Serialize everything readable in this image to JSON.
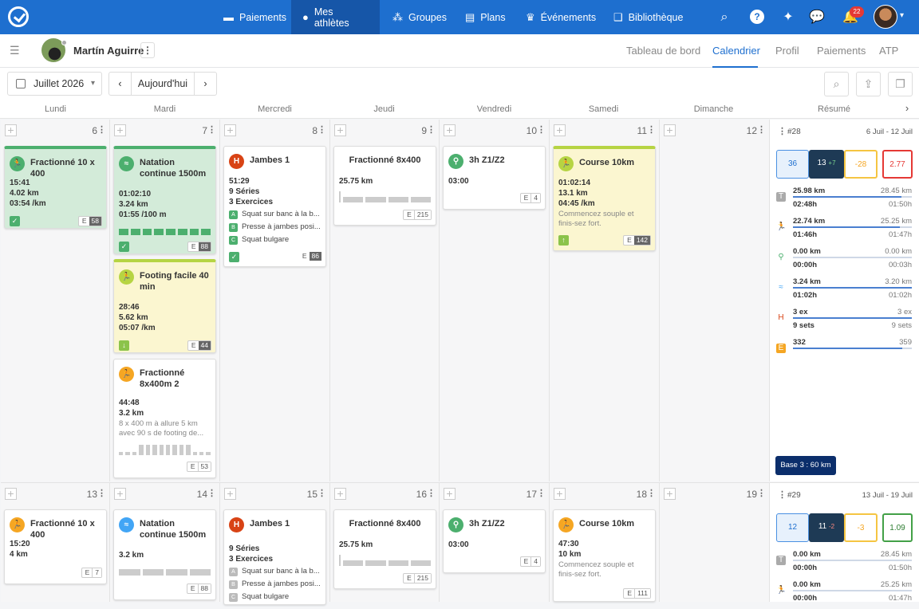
{
  "nav": {
    "items": [
      {
        "label": "Paiements",
        "icon": "credit-card-icon"
      },
      {
        "label": "Mes athlètes",
        "icon": "person-icon"
      },
      {
        "label": "Groupes",
        "icon": "group-icon"
      },
      {
        "label": "Plans",
        "icon": "clipboard-icon"
      },
      {
        "label": "Événements",
        "icon": "trophy-icon"
      },
      {
        "label": "Bibliothèque",
        "icon": "book-icon"
      }
    ],
    "notification_count": "22"
  },
  "athlete": {
    "name": "Martín Aguirre"
  },
  "tabs": [
    "Tableau de bord",
    "Calendrier",
    "Profil",
    "Paiements",
    "ATP"
  ],
  "toolbar": {
    "month": "Juillet 2026",
    "today": "Aujourd'hui"
  },
  "days": [
    "Lundi",
    "Mardi",
    "Mercredi",
    "Jeudi",
    "Vendredi",
    "Samedi",
    "Dimanche",
    "Résumé"
  ],
  "week1": {
    "daynums": [
      "6",
      "7",
      "8",
      "9",
      "10",
      "11",
      "12"
    ],
    "summary": {
      "week": "#28",
      "range": "6 Juil - 12 Juil",
      "kpis": [
        "36",
        "13",
        "+7",
        "-28",
        "2.77"
      ],
      "rows": [
        {
          "icon": "T",
          "a": "25.98 km",
          "ar": "28.45 km",
          "b": "02:48h",
          "br": "01:50h",
          "fill": 91
        },
        {
          "icon": "run",
          "a": "22.74 km",
          "ar": "25.25 km",
          "b": "01:46h",
          "br": "01:47h",
          "fill": 90
        },
        {
          "icon": "bike",
          "a": "0.00 km",
          "ar": "0.00 km",
          "b": "00:00h",
          "br": "00:03h",
          "fill": 0
        },
        {
          "icon": "swim",
          "a": "3.24 km",
          "ar": "3.20 km",
          "b": "01:02h",
          "br": "01:02h",
          "fill": 100
        },
        {
          "icon": "gym",
          "a": "3 ex",
          "ar": "3 ex",
          "b": "9 sets",
          "br": "9 sets",
          "fill": 100
        },
        {
          "icon": "E",
          "a": "332",
          "ar": "359",
          "b": "",
          "br": "",
          "fill": 92
        }
      ],
      "base": "Base 3 : 60 km"
    }
  },
  "week2": {
    "daynums": [
      "13",
      "14",
      "15",
      "16",
      "17",
      "18",
      "19"
    ],
    "summary": {
      "week": "#29",
      "range": "13 Juil - 19 Juil",
      "kpis": [
        "12",
        "11",
        "-2",
        "-3",
        "1.09"
      ],
      "rows": [
        {
          "icon": "T",
          "a": "0.00 km",
          "ar": "28.45 km",
          "b": "00:00h",
          "br": "01:50h",
          "fill": 0
        },
        {
          "icon": "run",
          "a": "0.00 km",
          "ar": "25.25 km",
          "b": "00:00h",
          "br": "01:47h",
          "fill": 0
        }
      ]
    }
  },
  "cards": {
    "w1_mon": {
      "title": "Fractionné 10 x 400",
      "l1": "15:41",
      "l2": "4.02 km",
      "l3": "03:54 /km",
      "e": "E",
      "en": "58"
    },
    "w1_tue1": {
      "title": "Natation continue 1500m",
      "l1": "01:02:10",
      "l2": "3.24 km",
      "l3": "01:55 /100 m",
      "e": "E",
      "en": "88"
    },
    "w1_tue2": {
      "title": "Footing facile 40 min",
      "l1": "28:46",
      "l2": "5.62 km",
      "l3": "05:07 /km",
      "e": "E",
      "en": "44"
    },
    "w1_tue3": {
      "title": "Fractionné 8x400m 2",
      "l1": "44:48",
      "l2": "3.2 km",
      "desc": "8 x 400 m à allure 5 km avec 90 s de footing de...",
      "e": "E",
      "en": "53"
    },
    "w1_wed": {
      "title": "Jambes 1",
      "l1": "51:29",
      "l2": "9 Séries",
      "l3": "3 Exercices",
      "ex": [
        {
          "k": "A",
          "t": "Squat sur banc à la b..."
        },
        {
          "k": "B",
          "t": "Presse à jambes posi..."
        },
        {
          "k": "C",
          "t": "Squat bulgare"
        }
      ],
      "e": "E",
      "en": "86"
    },
    "w1_thu": {
      "title": "Fractionné 8x400",
      "l1": "25.75 km",
      "e": "E",
      "en": "215"
    },
    "w1_fri": {
      "title": "3h Z1/Z2",
      "l1": "03:00",
      "e": "E",
      "en": "4"
    },
    "w1_sat": {
      "title": "Course 10km",
      "l1": "01:02:14",
      "l2": "13.1 km",
      "l3": "04:45 /km",
      "desc": "Commencez souple et finis-sez fort.",
      "e": "E",
      "en": "142"
    },
    "w2_mon": {
      "title": "Fractionné 10 x 400",
      "l1": "15:20",
      "l2": "4 km",
      "e": "E",
      "en": "7"
    },
    "w2_tue": {
      "title": "Natation continue 1500m",
      "l1": "3.2 km",
      "e": "E",
      "en": "88"
    },
    "w2_wed": {
      "title": "Jambes 1",
      "l1": "9 Séries",
      "l2": "3 Exercices",
      "ex": [
        {
          "k": "A",
          "t": "Squat sur banc à la b..."
        },
        {
          "k": "B",
          "t": "Presse à jambes posi..."
        },
        {
          "k": "C",
          "t": "Squat bulgare"
        }
      ]
    },
    "w2_thu": {
      "title": "Fractionné 8x400",
      "l1": "25.75 km",
      "e": "E",
      "en": "215"
    },
    "w2_fri": {
      "title": "3h Z1/Z2",
      "l1": "03:00",
      "e": "E",
      "en": "4"
    },
    "w2_sat": {
      "title": "Course 10km",
      "l1": "47:30",
      "l2": "10 km",
      "desc": "Commencez souple et finis-sez fort.",
      "e": "E",
      "en": "111"
    }
  },
  "colors": {
    "brand": "#1e6fcf",
    "completed": "#4caf6e",
    "run": "#f5a623",
    "bike": "#4caf6e",
    "swim": "#42a5f5",
    "gym": "#d84315"
  }
}
